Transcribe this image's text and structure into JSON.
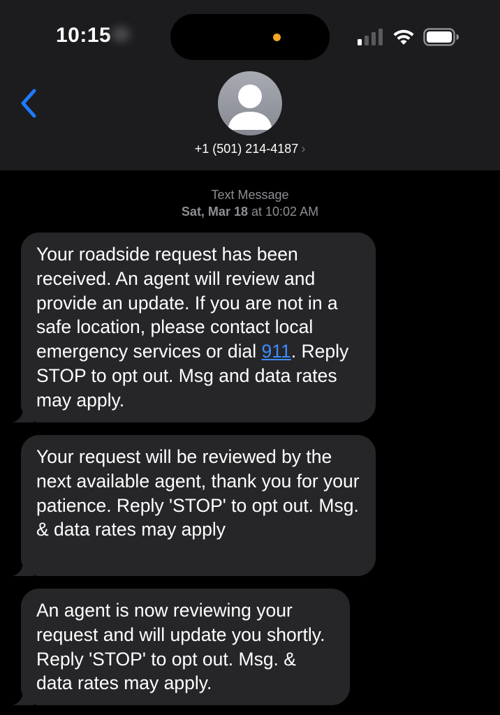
{
  "status_bar": {
    "time": "10:15"
  },
  "header": {
    "contact": "+1 (501) 214-4187",
    "chevron": "›"
  },
  "thread": {
    "service": "Text Message",
    "date": "Sat, Mar 18",
    "at": "at",
    "time": "10:02 AM"
  },
  "messages": [
    {
      "before": "Your roadside request has been received.  An agent will review and provide an update.  If you are not in a safe location, please contact local emergency services or dial ",
      "link": "911",
      "after": ".  Reply STOP to opt out. Msg and data rates may apply."
    },
    {
      "text": "Your request will be reviewed by the next available agent, thank you for your patience. Reply 'STOP' to opt out. Msg. & data rates may apply"
    },
    {
      "text": "An agent is now reviewing your request and will update you shortly. Reply 'STOP' to opt out. Msg. & data rates may apply."
    }
  ],
  "colors": {
    "header_bg": "#1c1c1e",
    "bubble_bg": "#262629",
    "accent": "#3d8cff",
    "recording_dot": "#f5a623"
  }
}
